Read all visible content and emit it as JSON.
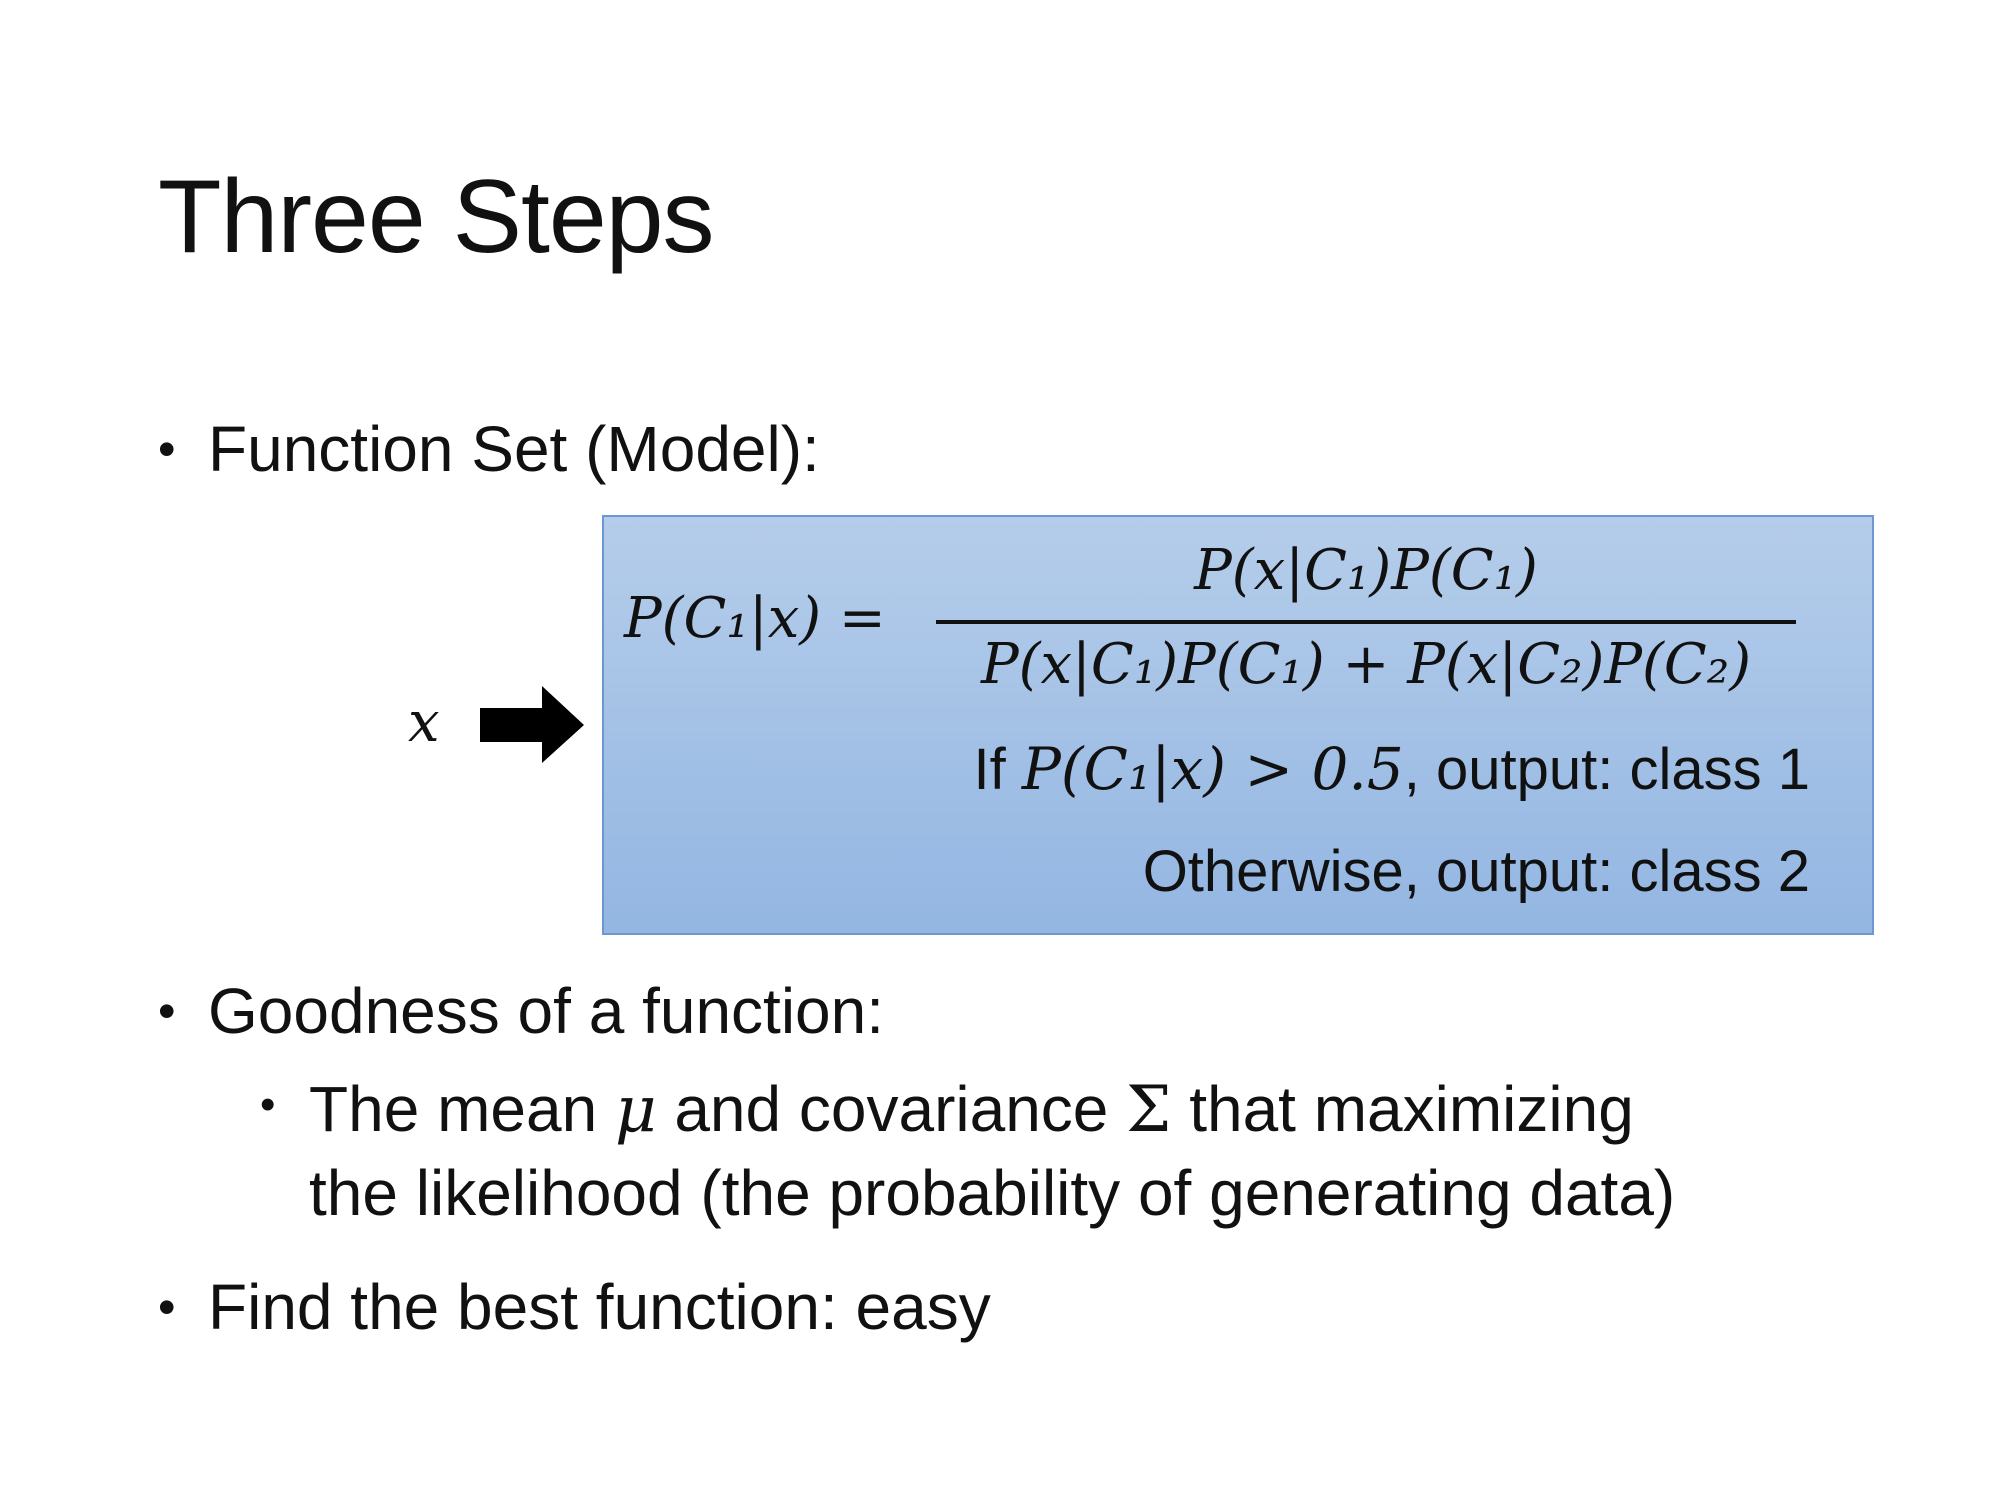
{
  "title": "Three Steps",
  "bullets": {
    "function_set": "Function Set (Model):",
    "goodness": "Goodness of a function:",
    "sub_line1_a": "The mean ",
    "sub_mu": "μ",
    "sub_line1_b": " and covariance ",
    "sub_sigma": "Σ",
    "sub_line1_c": " that maximizing",
    "sub_line2": "the likelihood (the probability of generating data)",
    "find": "Find the best function: easy",
    "bullet_char": "•"
  },
  "diagram": {
    "input_var": "x",
    "arrow_icon": "right-arrow-icon",
    "lhs": "P(C₁|x) =",
    "numerator": "P(x|C₁)P(C₁)",
    "denominator": "P(x|C₁)P(C₁) + P(x|C₂)P(C₂)",
    "rule_if": "If",
    "rule_cond": "P(C₁|x) > 0.5",
    "rule_then": ", output: class 1",
    "otherwise": "Otherwise, output: class 2"
  },
  "colors": {
    "box_top": "#b5cdea",
    "box_bottom": "#93b6e2",
    "box_border": "#6b98d0"
  }
}
